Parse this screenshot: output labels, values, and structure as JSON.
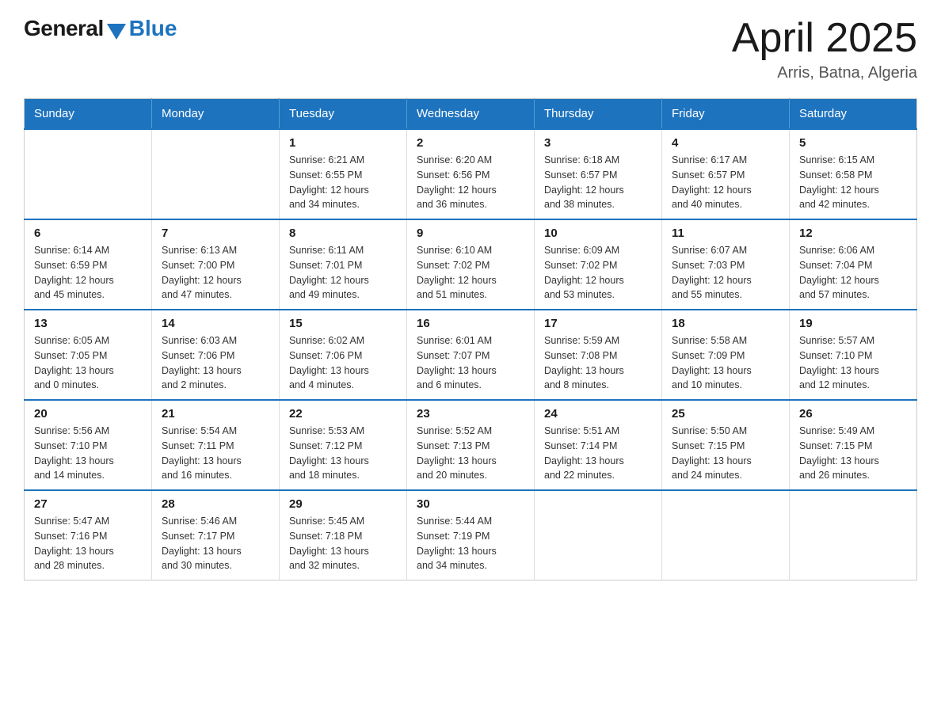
{
  "logo": {
    "general": "General",
    "blue": "Blue"
  },
  "title": "April 2025",
  "location": "Arris, Batna, Algeria",
  "days_of_week": [
    "Sunday",
    "Monday",
    "Tuesday",
    "Wednesday",
    "Thursday",
    "Friday",
    "Saturday"
  ],
  "weeks": [
    [
      {
        "day": "",
        "info": ""
      },
      {
        "day": "",
        "info": ""
      },
      {
        "day": "1",
        "info": "Sunrise: 6:21 AM\nSunset: 6:55 PM\nDaylight: 12 hours\nand 34 minutes."
      },
      {
        "day": "2",
        "info": "Sunrise: 6:20 AM\nSunset: 6:56 PM\nDaylight: 12 hours\nand 36 minutes."
      },
      {
        "day": "3",
        "info": "Sunrise: 6:18 AM\nSunset: 6:57 PM\nDaylight: 12 hours\nand 38 minutes."
      },
      {
        "day": "4",
        "info": "Sunrise: 6:17 AM\nSunset: 6:57 PM\nDaylight: 12 hours\nand 40 minutes."
      },
      {
        "day": "5",
        "info": "Sunrise: 6:15 AM\nSunset: 6:58 PM\nDaylight: 12 hours\nand 42 minutes."
      }
    ],
    [
      {
        "day": "6",
        "info": "Sunrise: 6:14 AM\nSunset: 6:59 PM\nDaylight: 12 hours\nand 45 minutes."
      },
      {
        "day": "7",
        "info": "Sunrise: 6:13 AM\nSunset: 7:00 PM\nDaylight: 12 hours\nand 47 minutes."
      },
      {
        "day": "8",
        "info": "Sunrise: 6:11 AM\nSunset: 7:01 PM\nDaylight: 12 hours\nand 49 minutes."
      },
      {
        "day": "9",
        "info": "Sunrise: 6:10 AM\nSunset: 7:02 PM\nDaylight: 12 hours\nand 51 minutes."
      },
      {
        "day": "10",
        "info": "Sunrise: 6:09 AM\nSunset: 7:02 PM\nDaylight: 12 hours\nand 53 minutes."
      },
      {
        "day": "11",
        "info": "Sunrise: 6:07 AM\nSunset: 7:03 PM\nDaylight: 12 hours\nand 55 minutes."
      },
      {
        "day": "12",
        "info": "Sunrise: 6:06 AM\nSunset: 7:04 PM\nDaylight: 12 hours\nand 57 minutes."
      }
    ],
    [
      {
        "day": "13",
        "info": "Sunrise: 6:05 AM\nSunset: 7:05 PM\nDaylight: 13 hours\nand 0 minutes."
      },
      {
        "day": "14",
        "info": "Sunrise: 6:03 AM\nSunset: 7:06 PM\nDaylight: 13 hours\nand 2 minutes."
      },
      {
        "day": "15",
        "info": "Sunrise: 6:02 AM\nSunset: 7:06 PM\nDaylight: 13 hours\nand 4 minutes."
      },
      {
        "day": "16",
        "info": "Sunrise: 6:01 AM\nSunset: 7:07 PM\nDaylight: 13 hours\nand 6 minutes."
      },
      {
        "day": "17",
        "info": "Sunrise: 5:59 AM\nSunset: 7:08 PM\nDaylight: 13 hours\nand 8 minutes."
      },
      {
        "day": "18",
        "info": "Sunrise: 5:58 AM\nSunset: 7:09 PM\nDaylight: 13 hours\nand 10 minutes."
      },
      {
        "day": "19",
        "info": "Sunrise: 5:57 AM\nSunset: 7:10 PM\nDaylight: 13 hours\nand 12 minutes."
      }
    ],
    [
      {
        "day": "20",
        "info": "Sunrise: 5:56 AM\nSunset: 7:10 PM\nDaylight: 13 hours\nand 14 minutes."
      },
      {
        "day": "21",
        "info": "Sunrise: 5:54 AM\nSunset: 7:11 PM\nDaylight: 13 hours\nand 16 minutes."
      },
      {
        "day": "22",
        "info": "Sunrise: 5:53 AM\nSunset: 7:12 PM\nDaylight: 13 hours\nand 18 minutes."
      },
      {
        "day": "23",
        "info": "Sunrise: 5:52 AM\nSunset: 7:13 PM\nDaylight: 13 hours\nand 20 minutes."
      },
      {
        "day": "24",
        "info": "Sunrise: 5:51 AM\nSunset: 7:14 PM\nDaylight: 13 hours\nand 22 minutes."
      },
      {
        "day": "25",
        "info": "Sunrise: 5:50 AM\nSunset: 7:15 PM\nDaylight: 13 hours\nand 24 minutes."
      },
      {
        "day": "26",
        "info": "Sunrise: 5:49 AM\nSunset: 7:15 PM\nDaylight: 13 hours\nand 26 minutes."
      }
    ],
    [
      {
        "day": "27",
        "info": "Sunrise: 5:47 AM\nSunset: 7:16 PM\nDaylight: 13 hours\nand 28 minutes."
      },
      {
        "day": "28",
        "info": "Sunrise: 5:46 AM\nSunset: 7:17 PM\nDaylight: 13 hours\nand 30 minutes."
      },
      {
        "day": "29",
        "info": "Sunrise: 5:45 AM\nSunset: 7:18 PM\nDaylight: 13 hours\nand 32 minutes."
      },
      {
        "day": "30",
        "info": "Sunrise: 5:44 AM\nSunset: 7:19 PM\nDaylight: 13 hours\nand 34 minutes."
      },
      {
        "day": "",
        "info": ""
      },
      {
        "day": "",
        "info": ""
      },
      {
        "day": "",
        "info": ""
      }
    ]
  ]
}
